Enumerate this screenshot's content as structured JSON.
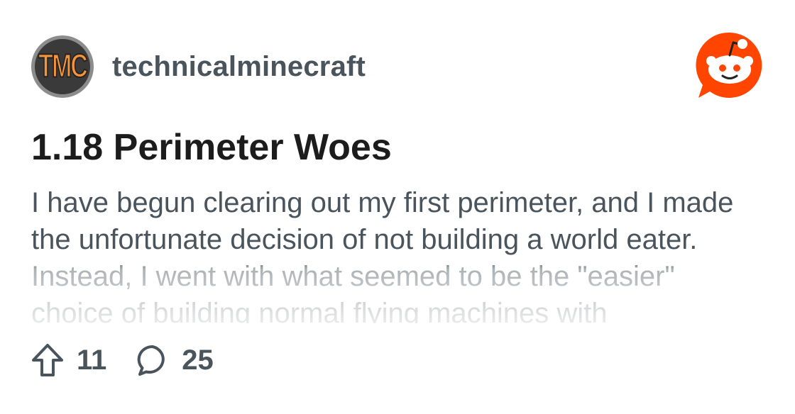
{
  "subreddit": {
    "icon_text": "TMC",
    "name": "technicalminecraft"
  },
  "post": {
    "title": "1.18 Perimeter Woes",
    "body": "I have begun clearing out my first perimeter, and I made the unfortunate decision of not building a world eater. Instead, I went with what seemed to be the \"easier\" choice of building normal flying machines with"
  },
  "stats": {
    "upvotes": "11",
    "comments": "25"
  },
  "icons": {
    "upvote": "upvote-arrow-icon",
    "comments": "comment-bubble-icon",
    "brand": "reddit-logo-icon"
  },
  "colors": {
    "brand": "#ff4500",
    "text_muted": "#4a545c",
    "title": "#1c1c1c",
    "tmc_orange": "#f7943a"
  }
}
